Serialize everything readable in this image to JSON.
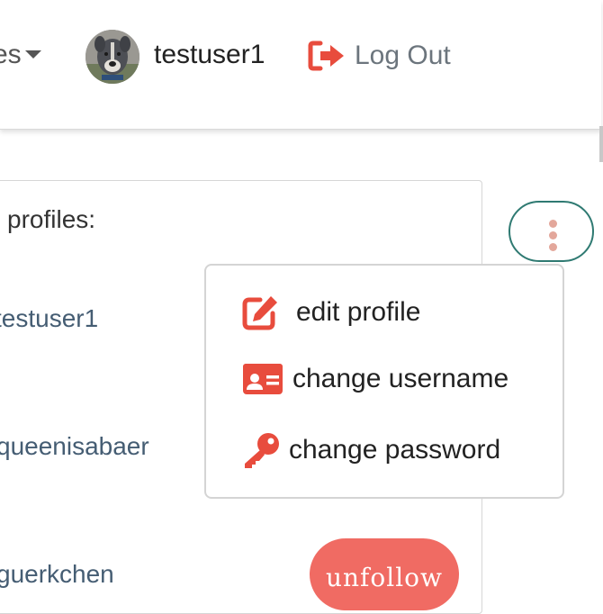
{
  "navbar": {
    "partial_menu_label": "es",
    "username": "testuser1",
    "logout_label": "Log Out"
  },
  "profiles": {
    "heading": "profiles:",
    "items": [
      {
        "name": "testuser1"
      },
      {
        "name": "queenisabaer"
      },
      {
        "name": "guerkchen"
      }
    ],
    "unfollow_label": "unfollow"
  },
  "dropdown": {
    "items": [
      {
        "label": "edit profile",
        "icon": "edit-icon"
      },
      {
        "label": "change username",
        "icon": "id-card-icon"
      },
      {
        "label": "change password",
        "icon": "key-icon"
      }
    ]
  },
  "colors": {
    "accent_red": "#e84c3d",
    "kebab_border": "#2f7a72",
    "kebab_dots": "#e3a79b",
    "unfollow_bg": "#f06b63",
    "link_text": "#455d73"
  }
}
